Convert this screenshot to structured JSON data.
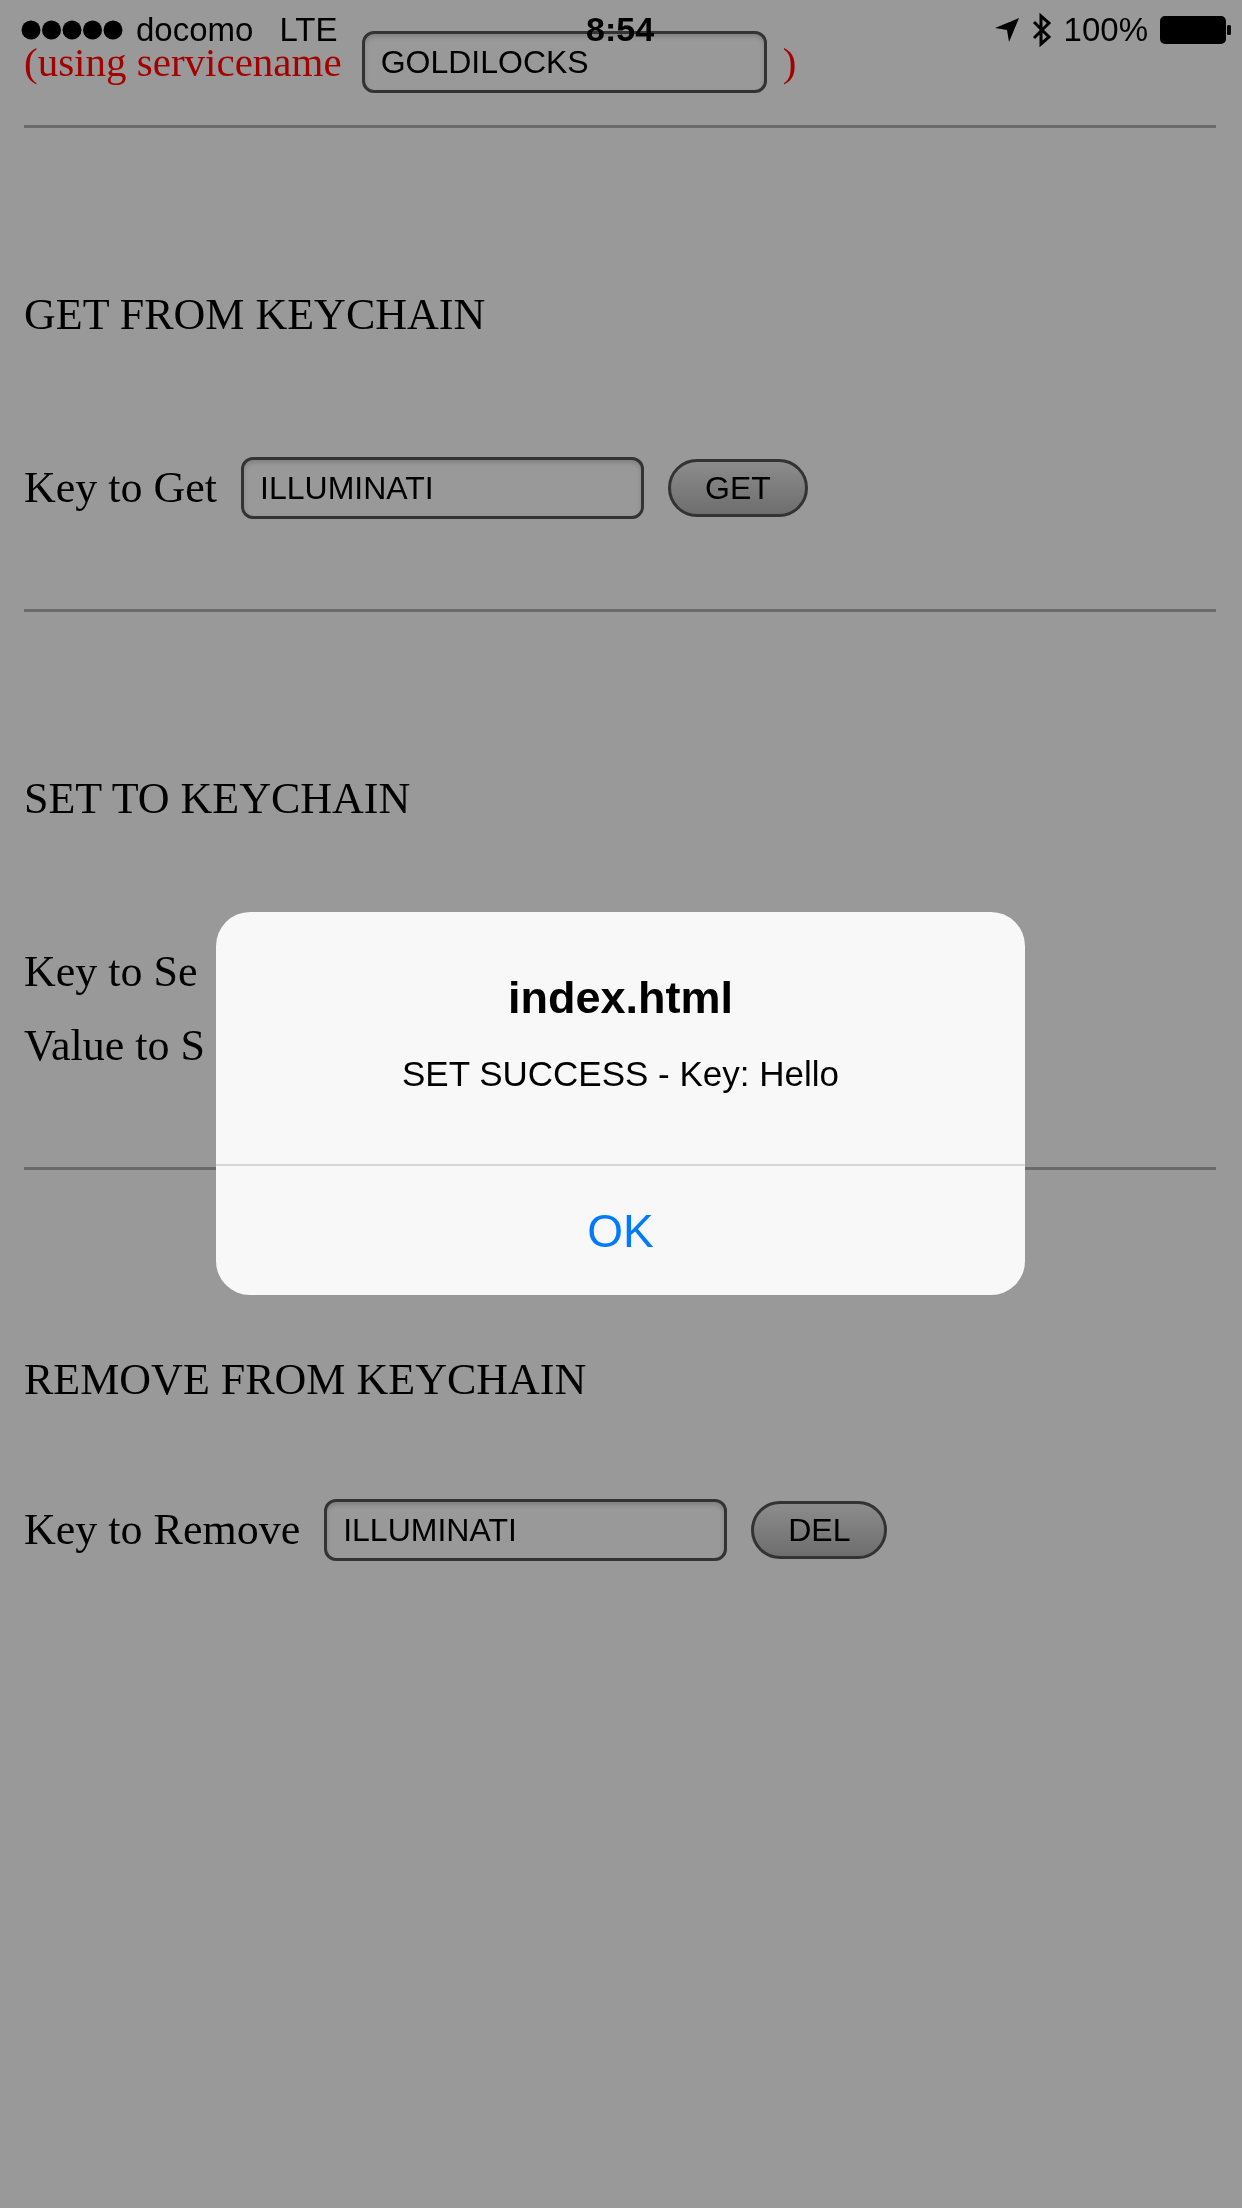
{
  "status_bar": {
    "carrier": "docomo",
    "network": "LTE",
    "time": "8:54",
    "battery": "100%"
  },
  "service": {
    "prefix": "(using servicename",
    "value": "GOLDILOCKS",
    "suffix": ")"
  },
  "sections": [
    {
      "heading": "GET FROM KEYCHAIN",
      "rows": [
        {
          "label": "Key to Get",
          "value": "ILLUMINATI",
          "button": "GET"
        }
      ]
    },
    {
      "heading": "SET TO KEYCHAIN",
      "rows": [
        {
          "label": "Key to Se"
        },
        {
          "label": "Value to S"
        }
      ]
    },
    {
      "heading": "REMOVE FROM KEYCHAIN",
      "rows": [
        {
          "label": "Key to Remove",
          "value": "ILLUMINATI",
          "button": "DEL"
        }
      ]
    }
  ],
  "alert": {
    "title": "index.html",
    "message": "SET SUCCESS - Key: Hello",
    "button": "OK"
  }
}
